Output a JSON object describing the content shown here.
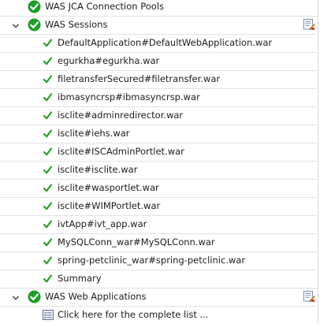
{
  "tree": {
    "pools": {
      "label": "WAS JCA Connection Pools"
    },
    "sessions": {
      "label": "WAS Sessions",
      "children": [
        "DefaultApplication#DefaultWebApplication.war",
        "egurkha#egurkha.war",
        "filetransferSecured#filetransfer.war",
        "ibmasyncrsp#ibmasyncrsp.war",
        "isclite#adminredirector.war",
        "isclite#iehs.war",
        "isclite#ISCAdminPortlet.war",
        "isclite#isclite.war",
        "isclite#wasportlet.war",
        "isclite#WIMPortlet.war",
        "ivtApp#ivt_app.war",
        "MySQLConn_war#MySQLConn.war",
        "spring-petclinic_war#spring-petclinic.war",
        "Summary"
      ]
    },
    "webapps": {
      "label": "WAS Web Applications",
      "children": [
        "Click here for the complete list ..."
      ]
    }
  },
  "colors": {
    "ok_green": "#1f9e2a",
    "check_green": "#2aa02a",
    "twisty": "#555555"
  }
}
